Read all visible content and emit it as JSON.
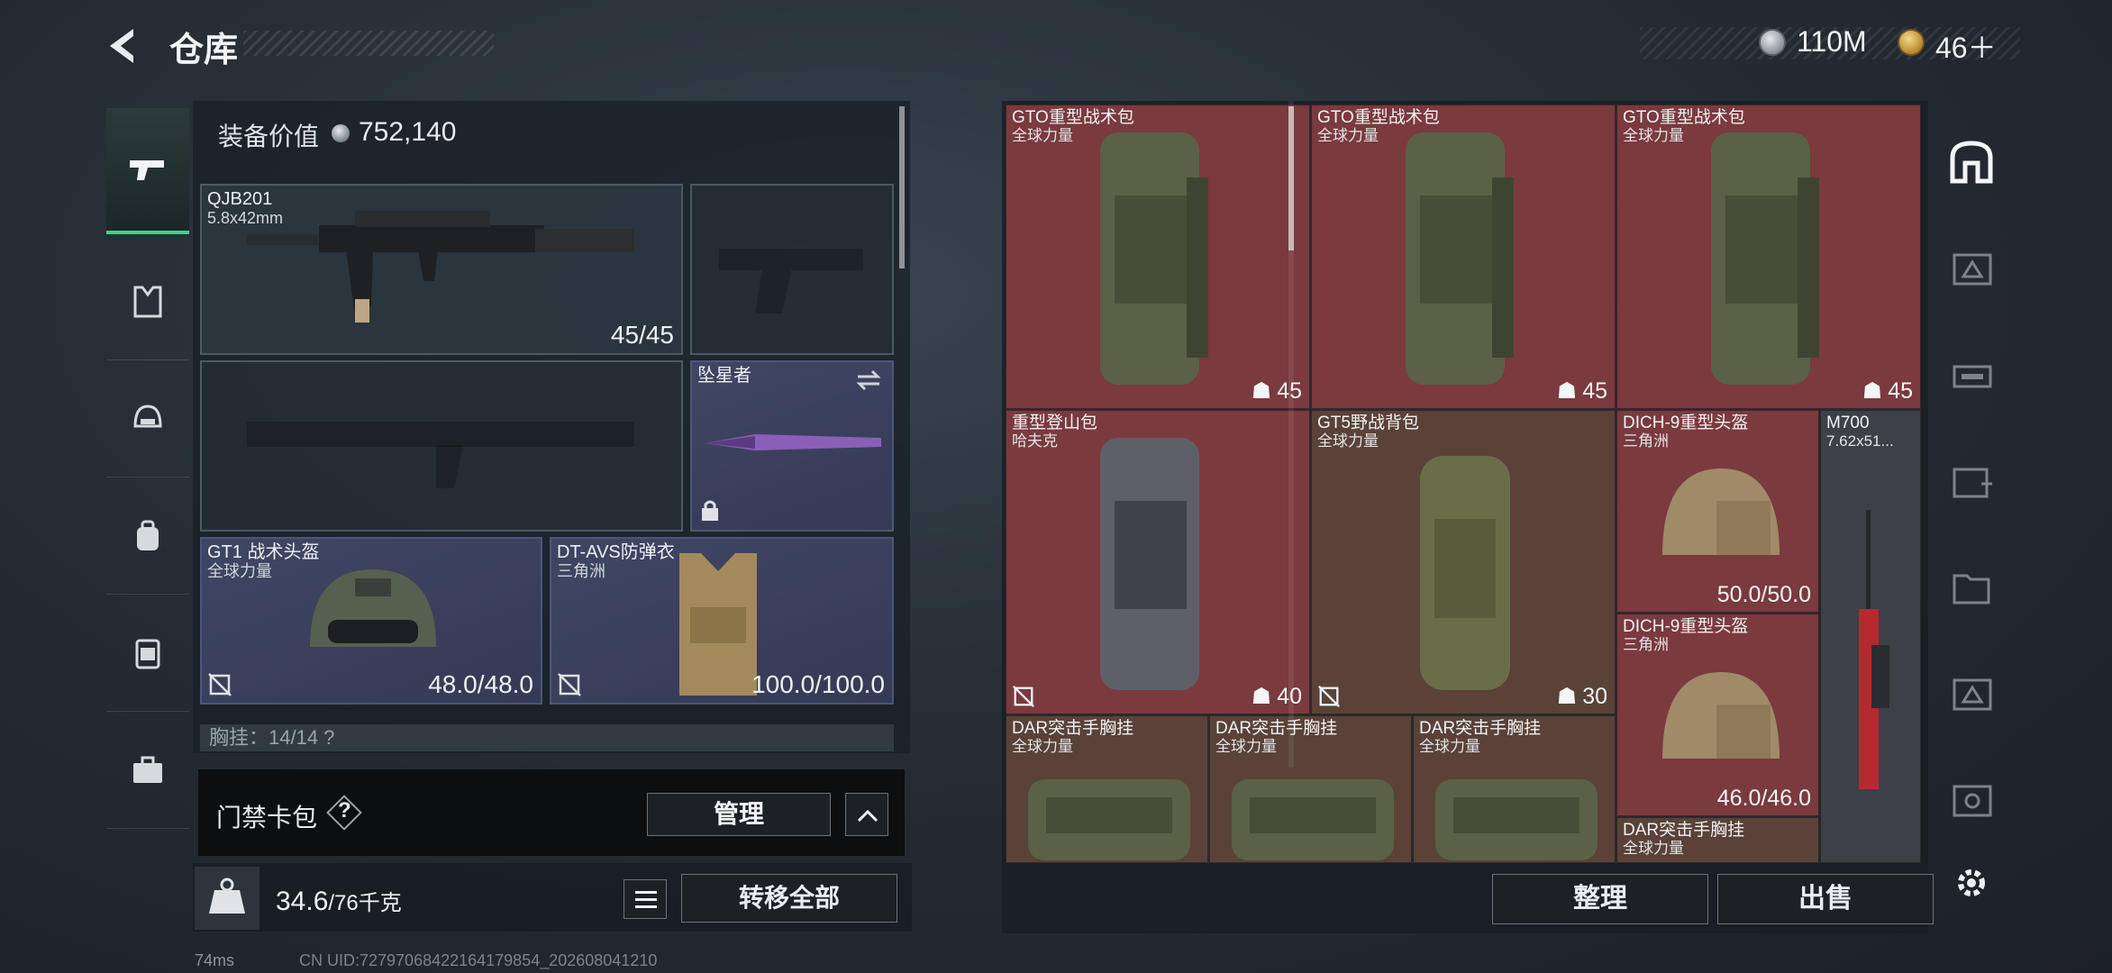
{
  "header": {
    "title": "仓库",
    "currency": {
      "coins": "110M",
      "tokens": "46＋"
    }
  },
  "rail": {
    "items": [
      {
        "name": "pistol-icon"
      },
      {
        "name": "armor-icon"
      },
      {
        "name": "helmet-icon"
      },
      {
        "name": "backpack-icon"
      },
      {
        "name": "chest-rig-icon"
      },
      {
        "name": "case-icon"
      }
    ]
  },
  "loadout": {
    "equip_value_label": "装备价值",
    "equip_value": "752,140",
    "primary": {
      "name": "QJB201",
      "ammo": "5.8x42mm",
      "value": "45/45"
    },
    "melee": {
      "name": "坠星者"
    },
    "helmet": {
      "name": "GT1 战术头盔",
      "sub": "全球力量",
      "value": "48.0/48.0"
    },
    "armor": {
      "name": "DT-AVS防弹衣",
      "sub": "三角洲",
      "value": "100.0/100.0"
    },
    "chest_row": "胸挂：14/14 ?",
    "keycard": {
      "label": "门禁卡包",
      "help": "?",
      "manage": "管理"
    },
    "weight": {
      "current": "34.6",
      "max": "/76千克"
    },
    "transfer_all": "转移全部"
  },
  "stash": {
    "items": [
      {
        "name": "GTO重型战术包",
        "sub": "全球力量",
        "cap": "45",
        "color": "red"
      },
      {
        "name": "GTO重型战术包",
        "sub": "全球力量",
        "cap": "45",
        "color": "red"
      },
      {
        "name": "GTO重型战术包",
        "sub": "全球力量",
        "cap": "45",
        "color": "red"
      },
      {
        "name": "重型登山包",
        "sub": "哈夫克",
        "cap": "40",
        "color": "red"
      },
      {
        "name": "GT5野战背包",
        "sub": "全球力量",
        "cap": "30",
        "color": "brown"
      },
      {
        "name": "DICH-9重型头盔",
        "sub": "三角洲",
        "value": "50.0/50.0",
        "color": "red"
      },
      {
        "name": "M700",
        "sub": "7.62x51...",
        "color": "dark"
      },
      {
        "name": "DICH-9重型头盔",
        "sub": "三角洲",
        "value": "46.0/46.0",
        "color": "red"
      },
      {
        "name": "DAR突击手胸挂",
        "sub": "全球力量",
        "color": "brown"
      },
      {
        "name": "DAR突击手胸挂",
        "sub": "全球力量",
        "color": "brown"
      },
      {
        "name": "DAR突击手胸挂",
        "sub": "全球力量",
        "color": "brown"
      },
      {
        "name": "DAR突击手胸挂",
        "sub": "全球力量",
        "color": "brown"
      }
    ],
    "sort": "整理",
    "sell": "出售"
  },
  "right_rail": [
    "home-icon",
    "II",
    "III",
    "IV",
    "IV",
    "III",
    "IV"
  ],
  "status": {
    "ping": "74ms",
    "uid": "CN UID:72797068422164179854_202608041210"
  },
  "colors": {
    "red_item": "#7a3a3e",
    "brown_item": "#5a4238",
    "accent_green": "#3fd28a"
  }
}
